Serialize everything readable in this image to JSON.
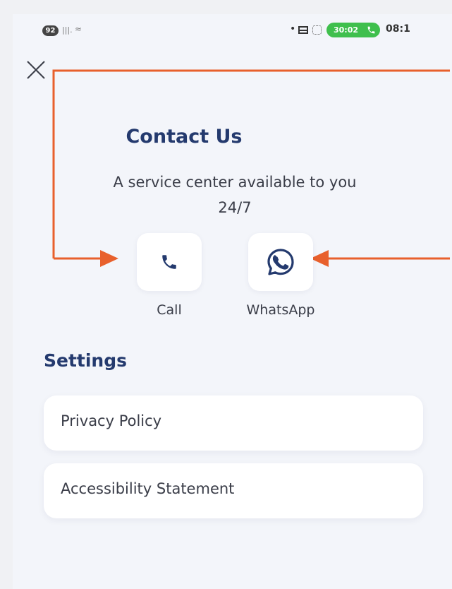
{
  "status_bar": {
    "notification_count": "92",
    "call_timer": "30:02",
    "time": "08:1"
  },
  "contact": {
    "title": "Contact Us",
    "subtitle_line1": "A service center available to you",
    "subtitle_line2": "24/7",
    "actions": [
      {
        "label": "Call",
        "icon": "phone-icon"
      },
      {
        "label": "WhatsApp",
        "icon": "whatsapp-icon"
      }
    ]
  },
  "settings": {
    "title": "Settings",
    "items": [
      {
        "label": "Privacy Policy"
      },
      {
        "label": "Accessibility Statement"
      }
    ]
  },
  "colors": {
    "heading": "#243a6e",
    "body_text": "#3a3d48",
    "screen_bg": "#f3f5fa",
    "card_bg": "#ffffff",
    "annotation": "#e8602c",
    "call_pill": "#3fbf4d"
  }
}
